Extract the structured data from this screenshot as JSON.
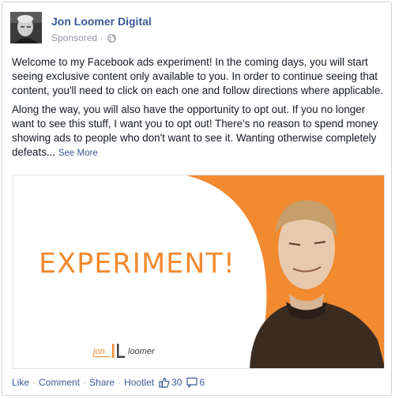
{
  "post": {
    "page_name": "Jon Loomer Digital",
    "sponsored_label": "Sponsored",
    "separator": "·",
    "paragraphs": [
      "Welcome to my Facebook ads experiment! In the coming days, you will start seeing exclusive content only available to you. In order to continue seeing that content, you'll need to click on each one and follow directions where applicable.",
      "Along the way, you will also have the opportunity to opt out. If you no longer want to see this stuff, I want you to opt out! There's no reason to spend money showing ads to people who don't want to see it. Wanting otherwise completely defeats..."
    ],
    "see_more": "See More"
  },
  "ad_image": {
    "headline": "EXPERIMENT!",
    "logo_text": "jon loomer",
    "accent_color": "#f28a30"
  },
  "actions": {
    "like": "Like",
    "comment": "Comment",
    "share": "Share",
    "hootlet": "Hootlet",
    "likes_count": "30",
    "comments_count": "6"
  },
  "colors": {
    "link": "#3b5998",
    "meta": "#9197a3",
    "orange": "#f28a30"
  },
  "icons": [
    "globe-icon",
    "thumbs-up-icon",
    "comment-icon"
  ]
}
